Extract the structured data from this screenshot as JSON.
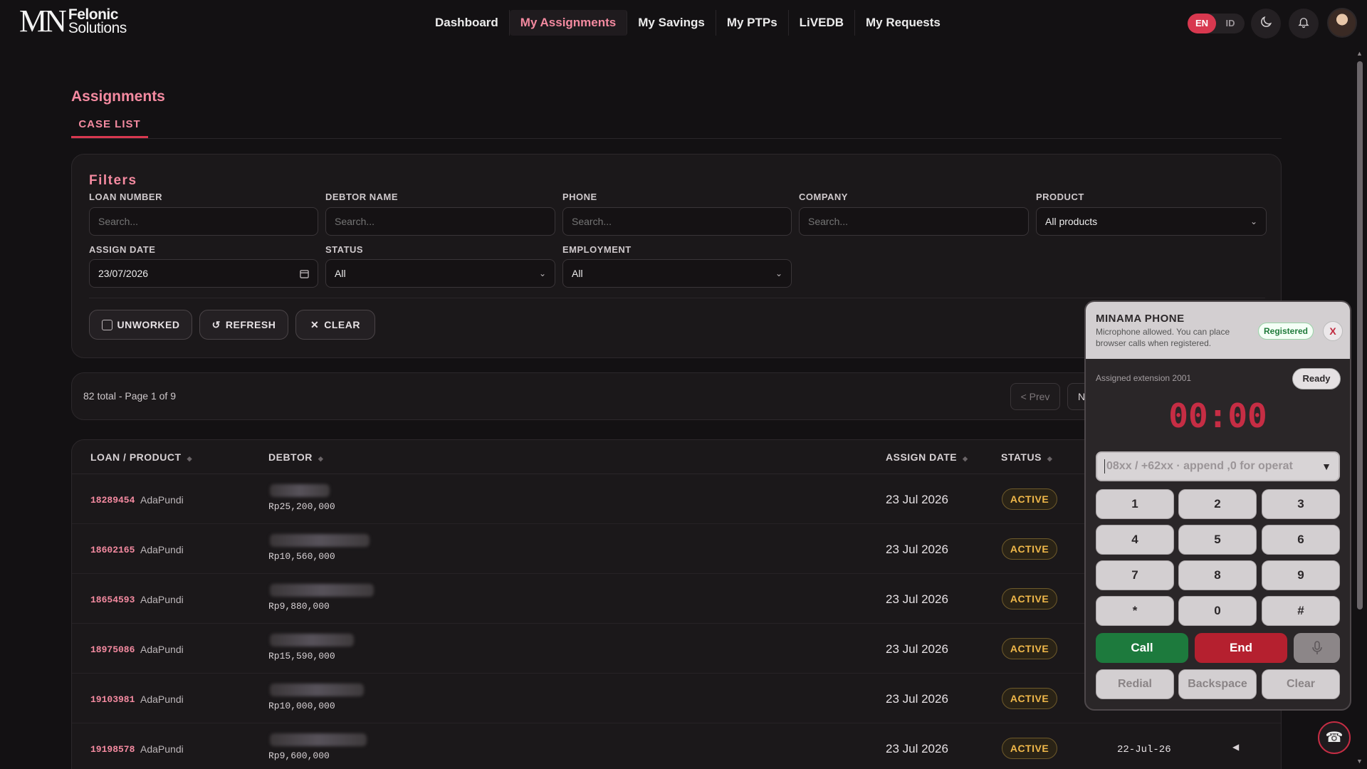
{
  "brand": {
    "mark": "MN",
    "line1": "Felonic",
    "line2": "Solutions"
  },
  "nav": {
    "items": [
      "Dashboard",
      "My Assignments",
      "My Savings",
      "My PTPs",
      "LiVEDB",
      "My Requests"
    ],
    "active": "My Assignments"
  },
  "lang": {
    "en": "EN",
    "id": "ID",
    "selected": "EN"
  },
  "icons": {
    "theme": "moon-icon",
    "notifications": "bell-icon"
  },
  "page": {
    "title": "Assignments",
    "tab": "CASE LIST"
  },
  "filters": {
    "title": "Filters",
    "loan_number": {
      "label": "LOAN NUMBER",
      "placeholder": "Search..."
    },
    "debtor_name": {
      "label": "DEBTOR NAME",
      "placeholder": "Search..."
    },
    "phone": {
      "label": "PHONE",
      "placeholder": "Search..."
    },
    "company": {
      "label": "COMPANY",
      "placeholder": "Search..."
    },
    "product": {
      "label": "PRODUCT",
      "value": "All products"
    },
    "assign_date": {
      "label": "ASSIGN DATE",
      "value": "23/07/2026"
    },
    "status": {
      "label": "STATUS",
      "value": "All"
    },
    "employment": {
      "label": "EMPLOYMENT",
      "value": "All"
    },
    "buttons": {
      "unworked": "UNWORKED",
      "refresh": "REFRESH",
      "clear": "CLEAR"
    }
  },
  "pagination": {
    "info": "82 total - Page 1 of 9",
    "prev": "< Prev",
    "next": "N"
  },
  "table": {
    "headers": {
      "loan": "LOAN / PRODUCT",
      "debtor": "DEBTOR",
      "assign_date": "ASSIGN DATE",
      "status": "STATUS"
    },
    "rows": [
      {
        "loan": "18289454",
        "product": "AdaPundi",
        "amount": "Rp25,200,000",
        "assign_date": "23 Jul 2026",
        "status": "ACTIVE",
        "due_date": ""
      },
      {
        "loan": "18602165",
        "product": "AdaPundi",
        "amount": "Rp10,560,000",
        "assign_date": "23 Jul 2026",
        "status": "ACTIVE",
        "due_date": ""
      },
      {
        "loan": "18654593",
        "product": "AdaPundi",
        "amount": "Rp9,880,000",
        "assign_date": "23 Jul 2026",
        "status": "ACTIVE",
        "due_date": ""
      },
      {
        "loan": "18975086",
        "product": "AdaPundi",
        "amount": "Rp15,590,000",
        "assign_date": "23 Jul 2026",
        "status": "ACTIVE",
        "due_date": ""
      },
      {
        "loan": "19103981",
        "product": "AdaPundi",
        "amount": "Rp10,000,000",
        "assign_date": "23 Jul 2026",
        "status": "ACTIVE",
        "due_date": ""
      },
      {
        "loan": "19198578",
        "product": "AdaPundi",
        "amount": "Rp9,600,000",
        "assign_date": "23 Jul 2026",
        "status": "ACTIVE",
        "due_date": "22-Jul-26"
      }
    ]
  },
  "phone": {
    "title": "MINAMA PHONE",
    "subtitle": "Microphone allowed. You can place browser calls when registered.",
    "registered": "Registered",
    "close": "X",
    "extension": "Assigned extension 2001",
    "ready": "Ready",
    "timer": "00:00",
    "placeholder": "08xx / +62xx · append ,0 for operat",
    "keys": [
      "1",
      "2",
      "3",
      "4",
      "5",
      "6",
      "7",
      "8",
      "9",
      "*",
      "0",
      "#"
    ],
    "call": "Call",
    "end": "End",
    "redial": "Redial",
    "backspace": "Backspace",
    "clear": "Clear"
  },
  "colors": {
    "accent": "#f48aa0",
    "brand_red": "#d8384f",
    "status_active": "#f0b84a",
    "call_green": "#1d7a3d",
    "end_red": "#b5202f"
  }
}
